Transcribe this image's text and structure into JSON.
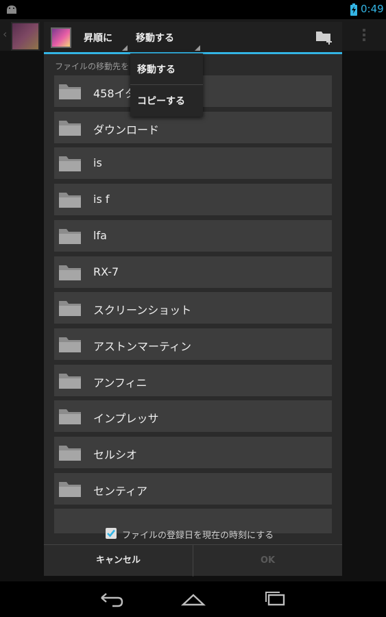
{
  "status_bar": {
    "time": "0:49"
  },
  "toolbar": {
    "sort_label": "昇順に",
    "action_label": "移動する"
  },
  "dialog": {
    "destination_label": "ファイルの移動先を",
    "folders": [
      "458イタ",
      "ダウンロード",
      "is",
      "is f",
      "lfa",
      "RX-7",
      "スクリーンショット",
      "アストンマーティン",
      "アンフィニ",
      "インプレッサ",
      "セルシオ",
      "センティア"
    ],
    "checkbox_label": "ファイルの登録日を現在の時刻にする",
    "checkbox_checked": true,
    "cancel_label": "キャンセル",
    "ok_label": "OK"
  },
  "dropdown": {
    "options": [
      "移動する",
      "コピーする"
    ]
  },
  "colors": {
    "accent": "#33b5e5",
    "dialog_bg": "#2b2b2b",
    "item_bg": "#3d3d3d"
  },
  "icons": [
    "android-icon",
    "battery-icon",
    "app-icon",
    "new-folder-icon",
    "folder-icon",
    "check-icon",
    "back-icon",
    "home-icon",
    "recents-icon",
    "overflow-icon"
  ]
}
